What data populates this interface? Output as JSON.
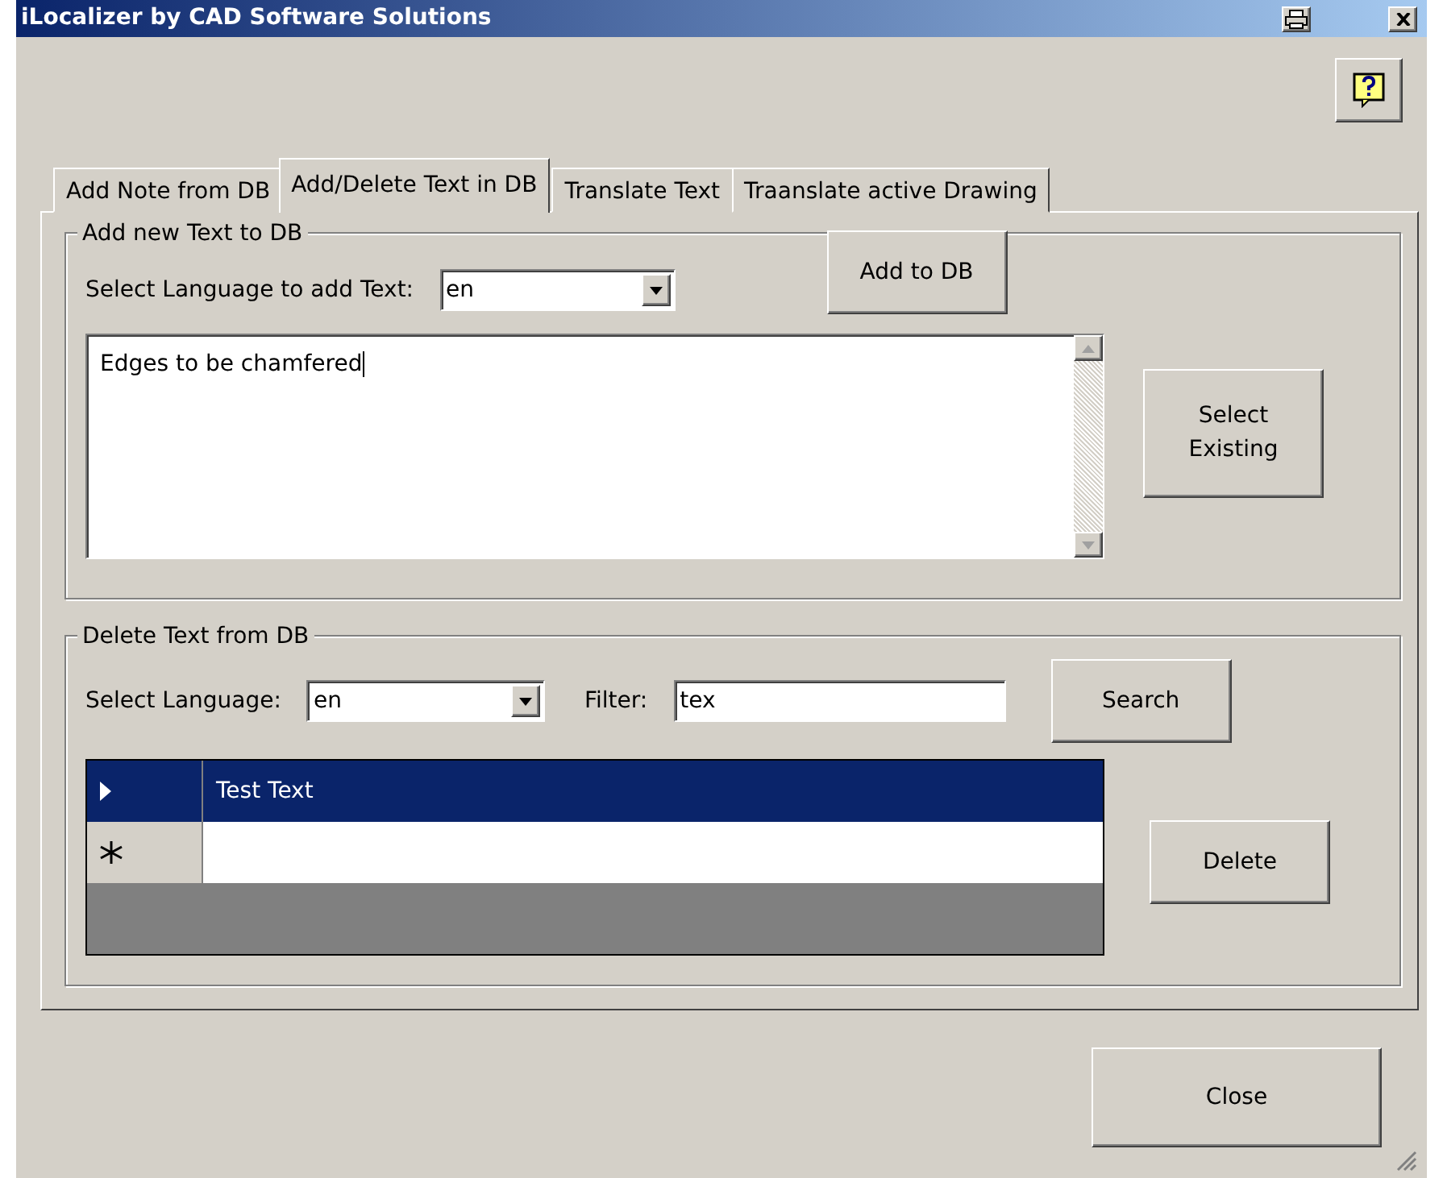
{
  "window": {
    "title": "iLocalizer by CAD Software Solutions"
  },
  "tabs": [
    {
      "label": "Add Note from DB",
      "selected": false
    },
    {
      "label": "Add/Delete Text in DB",
      "selected": true
    },
    {
      "label": "Translate Text",
      "selected": false
    },
    {
      "label": "Traanslate active Drawing",
      "selected": false
    }
  ],
  "add_group": {
    "title": "Add new Text to DB",
    "language_label": "Select Language to add Text:",
    "language_value": "en",
    "add_button": "Add to DB",
    "text_value": "Edges to be chamfered",
    "select_existing_button": "Select Existing"
  },
  "delete_group": {
    "title": "Delete Text from DB",
    "language_label": "Select Language:",
    "language_value": "en",
    "filter_label": "Filter:",
    "filter_value": "tex",
    "search_button": "Search",
    "delete_button": "Delete",
    "grid_rows": [
      {
        "kind": "current",
        "text": "Test Text",
        "selected": true
      },
      {
        "kind": "new",
        "selected": false
      }
    ]
  },
  "close_button": "Close"
}
